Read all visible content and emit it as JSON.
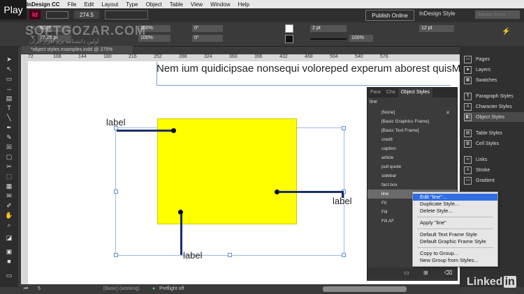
{
  "overlay": {
    "play_label": "Play"
  },
  "menubar": {
    "items": [
      "InDesign CC",
      "File",
      "Edit",
      "Layout",
      "Type",
      "Object",
      "Table",
      "View",
      "Window",
      "Help"
    ]
  },
  "appbar": {
    "logo": "Id",
    "zoom": "274.5",
    "publish_label": "Publish Online",
    "workspace": "InDesign Style",
    "search_placeholder": "Adobe Stock"
  },
  "controlbar": {
    "x": "60 pt",
    "y": "77.25 pt",
    "scale_x": "100%",
    "scale_y": "100%",
    "rotate": "0°",
    "shear": "0°",
    "stroke_weight": "2 pt",
    "opacity": "100%",
    "gap": "12 pt"
  },
  "watermark": {
    "site": "SOFTGOZAR.COM",
    "tagline": "اولین دانشنامه نرم افزار ایران"
  },
  "document": {
    "tab": "*object styles examples.indd @ 275%",
    "ruler_ticks": [
      "72",
      "108",
      "144",
      "180",
      "216",
      "252",
      "288",
      "324",
      "360",
      "396",
      "432",
      "468",
      "504",
      "540",
      "576"
    ]
  },
  "canvas": {
    "headline": "Nem ium quidicipsae nonsequi voloreped experum aborest quisMe",
    "label_1": "label",
    "label_2": "label",
    "label_3": "label"
  },
  "dock": {
    "items": [
      "Pages",
      "Layers",
      "Swatches",
      "Paragraph Styles",
      "Character Styles",
      "Object Styles",
      "Table Styles",
      "Cell Styles",
      "Links",
      "Stroke",
      "Gradient"
    ],
    "active": "Object Styles"
  },
  "object_styles_panel": {
    "tabs": [
      "Para",
      "Cha",
      "Object Styles"
    ],
    "current": "line",
    "styles": [
      "[None]",
      "[Basic Graphics Frame]",
      "[Basic Text Frame]",
      "credit",
      "caption",
      "article",
      "pull quote",
      "sidebar",
      "fact box",
      "line",
      "Fit",
      "Fill",
      "Fill AF"
    ],
    "selected": "line"
  },
  "context_menu": {
    "items": [
      "Edit \"line\"...",
      "Duplicate Style...",
      "Delete Style...",
      "Apply \"line\"",
      "Default Text Frame Style",
      "Default Graphic Frame Style",
      "Copy to Group...",
      "New Group from Styles..."
    ],
    "highlighted": "Edit \"line\"..."
  },
  "statusbar": {
    "page": "5",
    "style": "[Basic] (working)",
    "preflight": "Preflight off"
  },
  "branding": {
    "linkedin_text": "Linked",
    "linkedin_box": "in"
  },
  "colors": {
    "accent_yellow": "#ffff00",
    "menu_highlight": "#2f6de0",
    "line_color": "#1a2e6a"
  }
}
